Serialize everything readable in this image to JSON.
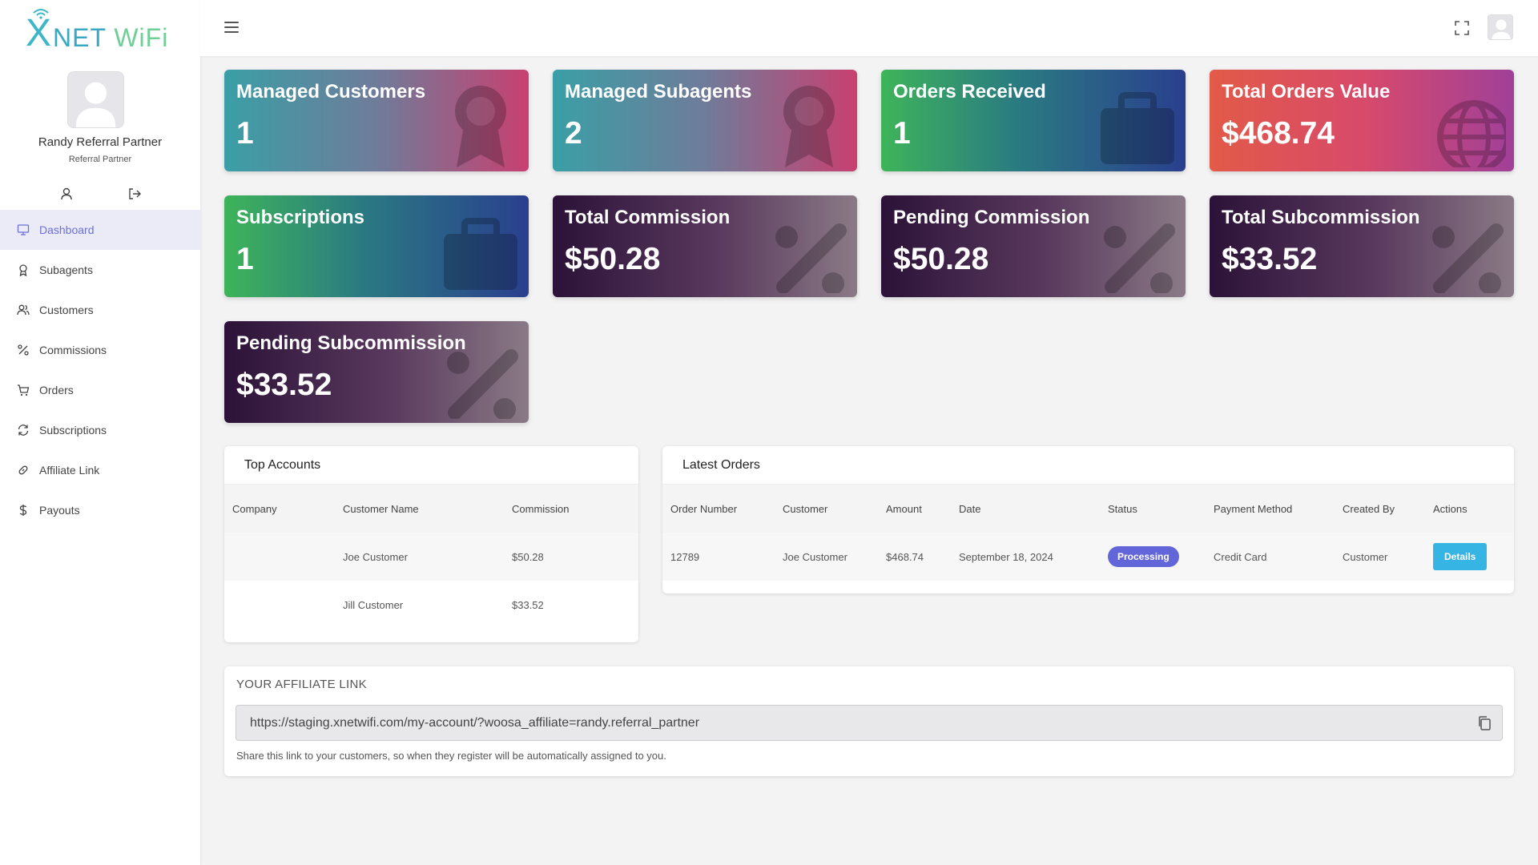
{
  "brand": {
    "logo_x": "X",
    "logo_rest": "NET ",
    "logo_wifi": "WiFi"
  },
  "user": {
    "name": "Randy Referral Partner",
    "role": "Referral Partner"
  },
  "nav": [
    {
      "label": "Dashboard",
      "icon": "monitor-icon",
      "active": true
    },
    {
      "label": "Subagents",
      "icon": "award-icon"
    },
    {
      "label": "Customers",
      "icon": "users-icon"
    },
    {
      "label": "Commissions",
      "icon": "percent-icon"
    },
    {
      "label": "Orders",
      "icon": "cart-icon"
    },
    {
      "label": "Subscriptions",
      "icon": "refresh-icon"
    },
    {
      "label": "Affiliate Link",
      "icon": "link-icon"
    },
    {
      "label": "Payouts",
      "icon": "dollar-icon"
    }
  ],
  "cards": [
    {
      "title": "Managed Customers",
      "value": "1",
      "icon": "award-icon"
    },
    {
      "title": "Managed Subagents",
      "value": "2",
      "icon": "award-icon"
    },
    {
      "title": "Orders Received",
      "value": "1",
      "icon": "briefcase-icon"
    },
    {
      "title": "Total Orders Value",
      "value": "$468.74",
      "icon": "globe-icon"
    },
    {
      "title": "Subscriptions",
      "value": "1",
      "icon": "briefcase-icon"
    },
    {
      "title": "Total Commission",
      "value": "$50.28",
      "icon": "percent-icon"
    },
    {
      "title": "Pending Commission",
      "value": "$50.28",
      "icon": "percent-icon"
    },
    {
      "title": "Total Subcommission",
      "value": "$33.52",
      "icon": "percent-icon"
    },
    {
      "title": "Pending Subcommission",
      "value": "$33.52",
      "icon": "percent-icon"
    }
  ],
  "top_accounts": {
    "title": "Top Accounts",
    "headers": [
      "Company",
      "Customer Name",
      "Commission"
    ],
    "rows": [
      [
        "",
        "Joe Customer",
        "$50.28"
      ],
      [
        "",
        "Jill Customer",
        "$33.52"
      ]
    ]
  },
  "latest_orders": {
    "title": "Latest Orders",
    "headers": [
      "Order Number",
      "Customer",
      "Amount",
      "Date",
      "Status",
      "Payment Method",
      "Created By",
      "Actions"
    ],
    "rows": [
      {
        "order_number": "12789",
        "customer": "Joe Customer",
        "amount": "$468.74",
        "date": "September 18, 2024",
        "status": "Processing",
        "payment_method": "Credit Card",
        "created_by": "Customer",
        "action": "Details"
      }
    ]
  },
  "affiliate": {
    "label": "YOUR AFFILIATE LINK",
    "url": "https://staging.xnetwifi.com/my-account/?woosa_affiliate=randy.referral_partner",
    "help": "Share this link to your customers, so when they register will be automatically assigned to you."
  },
  "colors": {
    "accent": "#6c6fd6",
    "badge": "#6366d8",
    "button": "#36b5e4"
  }
}
